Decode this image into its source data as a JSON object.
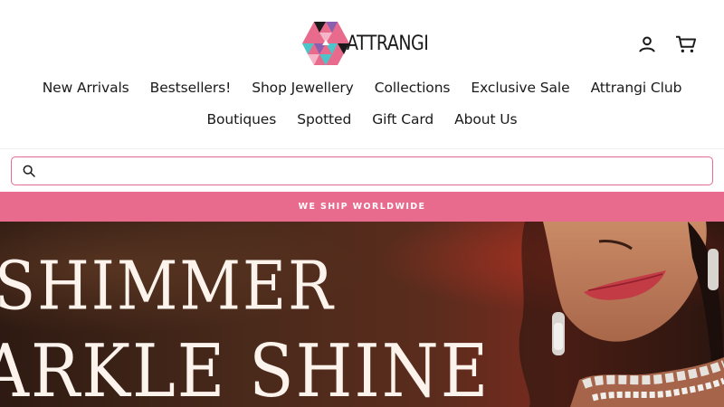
{
  "brand": {
    "name": "ATTRANGI",
    "colors": {
      "pink": "#e86b8e",
      "teal": "#4cc4c8",
      "purple": "#8a5fb0",
      "dark": "#1a1a1a"
    }
  },
  "header": {
    "account_icon": "user-icon",
    "cart_icon": "cart-icon"
  },
  "nav": {
    "row1": [
      "New Arrivals",
      "Bestsellers!",
      "Shop Jewellery",
      "Collections",
      "Exclusive Sale",
      "Attrangi Club"
    ],
    "row2": [
      "Boutiques",
      "Spotted",
      "Gift Card",
      "About Us"
    ]
  },
  "search": {
    "icon": "search-icon",
    "value": "",
    "placeholder": ""
  },
  "announcement": {
    "text": "WE SHIP WORLDWIDE",
    "background": "#e86b8e"
  },
  "hero": {
    "line1": "SHIMMER",
    "line2": "ARKLE SHINE"
  }
}
